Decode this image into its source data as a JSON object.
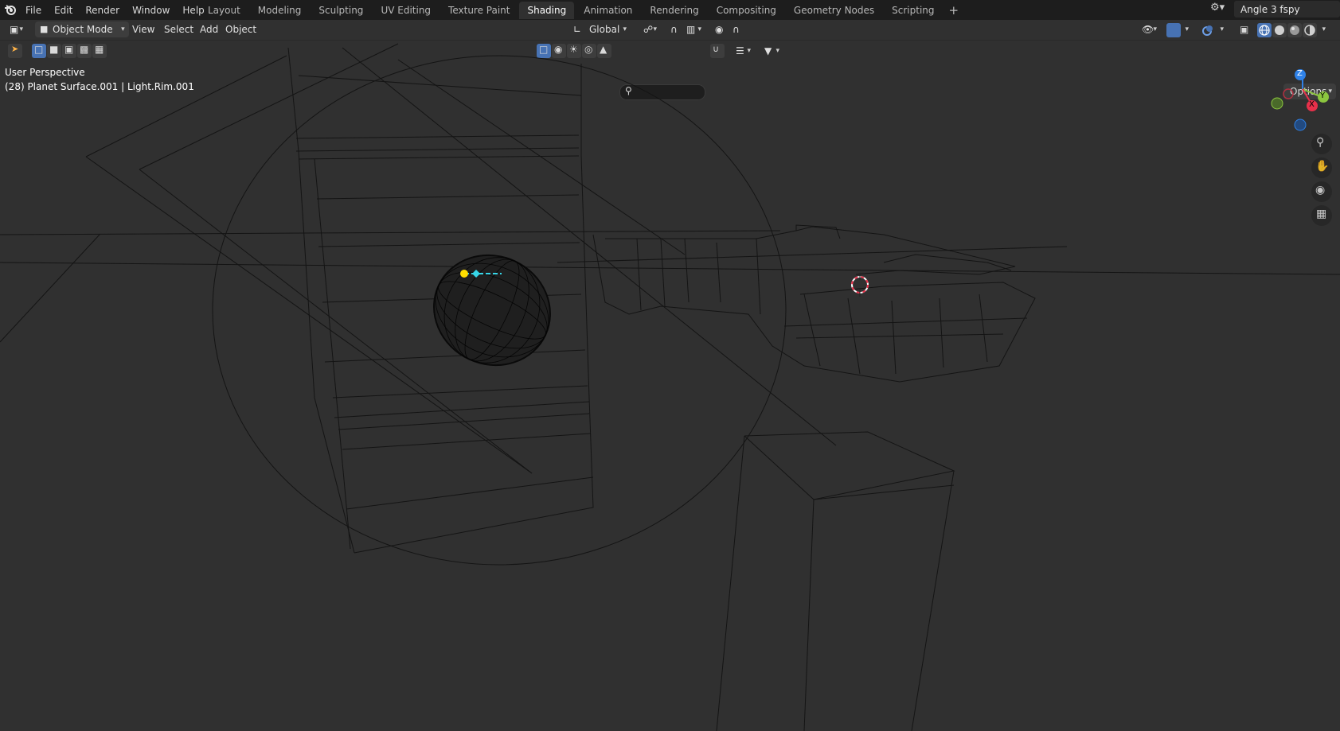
{
  "menu": [
    "File",
    "Edit",
    "Render",
    "Window",
    "Help"
  ],
  "workspace_tabs": [
    "Layout",
    "Modeling",
    "Sculpting",
    "UV Editing",
    "Texture Paint",
    "Shading",
    "Animation",
    "Rendering",
    "Compositing",
    "Geometry Nodes",
    "Scripting"
  ],
  "active_tab": "Shading",
  "scene_name": "Angle 3 fspy",
  "header": {
    "mode": "Object Mode",
    "view": "View",
    "select": "Select",
    "add": "Add",
    "object": "Object",
    "orientation": "Global",
    "options": "Options"
  },
  "viewport": {
    "perspective": "User Perspective",
    "active_info": "(28) Planet Surface.001 | Light.Rim.001"
  },
  "gizmo": {
    "z": "Z",
    "y": "Y",
    "x": "X"
  },
  "colors": {
    "active_tab": "#303030",
    "accent_blue": "#4772b3",
    "light_selected": "#ffde00",
    "light_line": "#37d6e8",
    "axis_x": "#e8304a",
    "axis_y": "#8cc63f",
    "axis_z": "#2f82e8"
  }
}
